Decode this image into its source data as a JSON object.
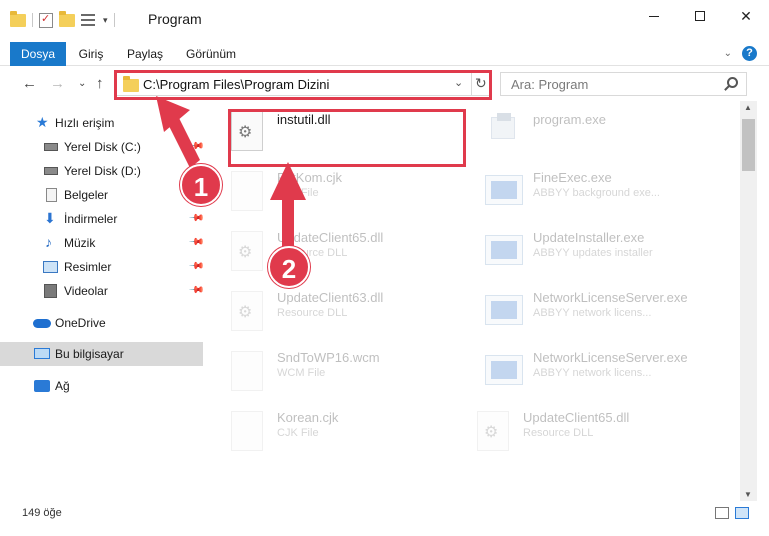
{
  "window": {
    "title": "Program",
    "minimize_label": "",
    "maximize_label": "",
    "close_label": "✕"
  },
  "ribbon": {
    "tabs": [
      {
        "label": "Dosya",
        "active": true
      },
      {
        "label": "Giriş",
        "active": false
      },
      {
        "label": "Paylaş",
        "active": false
      },
      {
        "label": "Görünüm",
        "active": false
      }
    ],
    "help_label": "?",
    "collapse_label": "⌄"
  },
  "nav": {
    "back": "←",
    "forward": "→",
    "recent": "⌄",
    "up": "↑",
    "address": "C:\\Program Files\\Program Dizini",
    "address_dropdown": "⌄",
    "refresh": "↻",
    "search_placeholder": "Ara: Program"
  },
  "sidebar": {
    "items": [
      {
        "label": "Hızlı erişim",
        "icon": "star-icon",
        "pinned": false
      },
      {
        "label": "Yerel Disk (C:)",
        "icon": "drive-icon",
        "pinned": true
      },
      {
        "label": "Yerel Disk (D:)",
        "icon": "drive-icon",
        "pinned": false
      },
      {
        "label": "Belgeler",
        "icon": "documents-icon",
        "pinned": true
      },
      {
        "label": "İndirmeler",
        "icon": "downloads-icon",
        "pinned": true
      },
      {
        "label": "Müzik",
        "icon": "music-icon",
        "pinned": true
      },
      {
        "label": "Resimler",
        "icon": "pictures-icon",
        "pinned": true
      },
      {
        "label": "Videolar",
        "icon": "videos-icon",
        "pinned": true
      },
      {
        "label": "OneDrive",
        "icon": "onedrive-icon",
        "pinned": false
      },
      {
        "label": "Bu bilgisayar",
        "icon": "this-pc-icon",
        "pinned": false,
        "selected": true
      },
      {
        "label": "Ağ",
        "icon": "network-icon",
        "pinned": false
      }
    ],
    "pin_glyph": "📌"
  },
  "files": {
    "left": [
      {
        "name": "instutil.dll",
        "desc": "",
        "icon": "dll-gear-icon",
        "faded": false
      },
      {
        "name": "FntKom.cjk",
        "desc": "CJK File",
        "icon": "file-icon",
        "faded": true
      },
      {
        "name": "UpdateClient65.dll",
        "desc": "Resource DLL",
        "icon": "dll-gear-icon",
        "faded": true
      },
      {
        "name": "UpdateClient63.dll",
        "desc": "Resource DLL",
        "icon": "dll-gear-icon",
        "faded": true
      },
      {
        "name": "SndToWP16.wcm",
        "desc": "WCM File",
        "icon": "file-icon",
        "faded": true
      },
      {
        "name": "Korean.cjk",
        "desc": "CJK File",
        "icon": "file-icon",
        "faded": true
      }
    ],
    "right": [
      {
        "name": "program.exe",
        "desc": "",
        "icon": "exe-icon",
        "faded": true
      },
      {
        "name": "FineExec.exe",
        "desc": "ABBYY background exe...",
        "icon": "app-window-icon",
        "faded": true
      },
      {
        "name": "UpdateInstaller.exe",
        "desc": "ABBYY updates installer",
        "icon": "app-window-icon",
        "faded": true
      },
      {
        "name": "NetworkLicenseServer.exe",
        "desc": "ABBYY network licens...",
        "icon": "app-window-icon",
        "faded": true
      },
      {
        "name": "NetworkLicenseServer.exe",
        "desc": "ABBYY network licens...",
        "icon": "app-window-icon",
        "faded": true
      },
      {
        "name": "UpdateClient65.dll",
        "desc": "Resource DLL",
        "icon": "dll-gear-icon",
        "faded": true
      }
    ]
  },
  "status": {
    "item_count": "149 öğe"
  },
  "annotations": {
    "badge_1": "1",
    "badge_2": "2",
    "color": "#e03a4c"
  },
  "colors": {
    "accent": "#1979ca",
    "highlight": "#e03a4c"
  }
}
